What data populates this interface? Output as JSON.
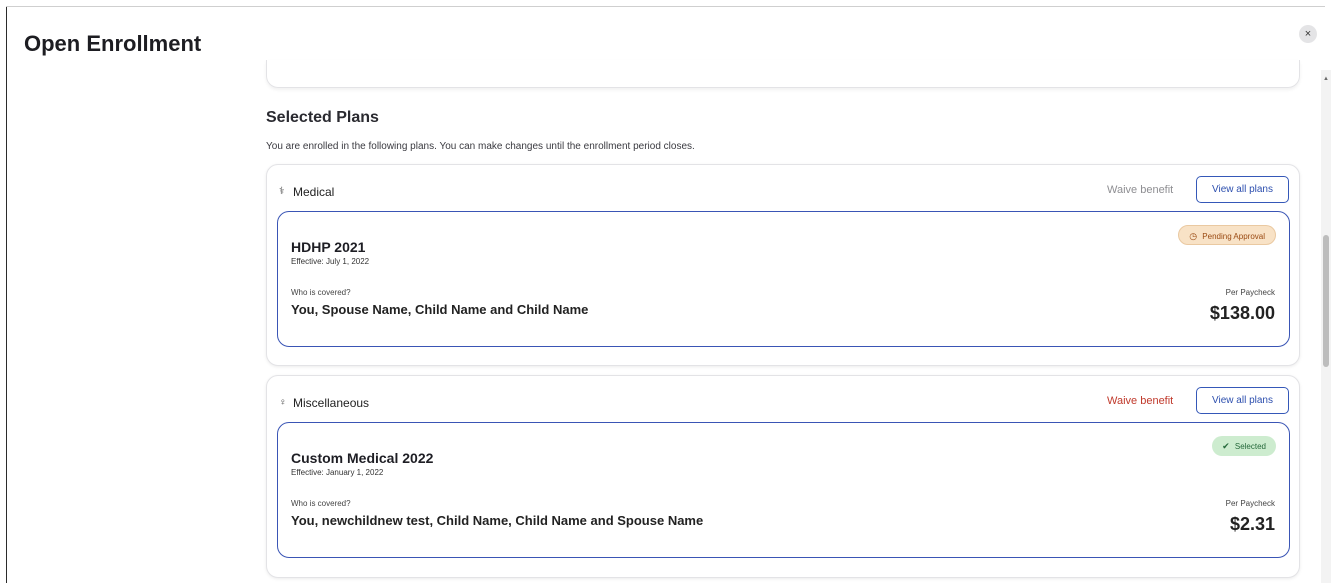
{
  "window": {
    "title": "Open Enrollment",
    "close_label": "×"
  },
  "section": {
    "title": "Selected Plans",
    "description": "You are enrolled in the following plans. You can make changes until the enrollment period closes."
  },
  "benefits": [
    {
      "icon": "stethoscope-icon",
      "icon_glyph": "⚕",
      "category": "Medical",
      "waive_label": "Waive benefit",
      "waive_color": "#8e8e92",
      "view_all_label": "View all plans",
      "plan": {
        "name": "HDHP 2021",
        "effective": "Effective: July 1, 2022",
        "status": "Pending Approval",
        "status_icon": "clock-icon",
        "status_glyph": "◷",
        "covered_label": "Who is covered?",
        "covered_value": "You, Spouse Name, Child Name and Child Name",
        "cost_label": "Per Paycheck",
        "cost_value": "$138.00"
      }
    },
    {
      "icon": "lightbulb-icon",
      "icon_glyph": "♀",
      "category": "Miscellaneous",
      "waive_label": "Waive benefit",
      "waive_color": "#c0392b",
      "view_all_label": "View all plans",
      "plan": {
        "name": "Custom Medical 2022",
        "effective": "Effective: January 1, 2022",
        "status": "Selected",
        "status_icon": "check-circle-icon",
        "status_glyph": "✔",
        "covered_label": "Who is covered?",
        "covered_value": "You, newchildnew test, Child Name, Child Name and Spouse Name",
        "cost_label": "Per Paycheck",
        "cost_value": "$2.31"
      }
    }
  ],
  "colors": {
    "accent": "#3a55b5",
    "pending_bg": "#f8e2c6",
    "pending_text": "#9a4a12",
    "selected_bg": "#cdeccf",
    "selected_text": "#25693a"
  }
}
